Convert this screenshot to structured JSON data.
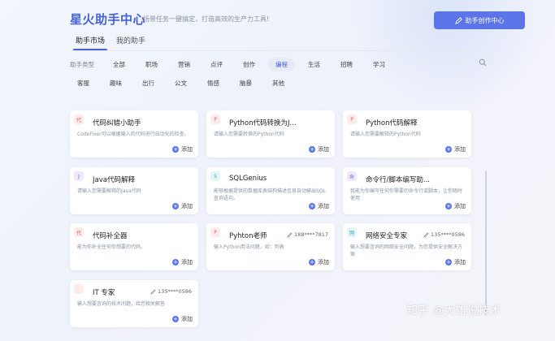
{
  "header": {
    "title": "星火助手中心",
    "slogan": "场景任务一键搞定，打造高效的生产力工具!",
    "create_button": "助手创作中心"
  },
  "tabs": [
    {
      "label": "助手市场",
      "active": true
    },
    {
      "label": "我的助手",
      "active": false
    }
  ],
  "filter": {
    "label": "助手类型",
    "row1": [
      "全部",
      "职场",
      "营销",
      "点评",
      "创作",
      "编程",
      "生活",
      "招聘",
      "学习"
    ],
    "row2": [
      "客服",
      "趣味",
      "出行",
      "公文",
      "情感",
      "脑暴",
      "其他"
    ],
    "active": "编程"
  },
  "add_label": "添加",
  "cards": [
    {
      "icon": "代",
      "icon_bg": "#fdecec",
      "icon_color": "#e05a5a",
      "title": "代码纠错小助手",
      "author": "",
      "desc": "CodeFixer可以根据输入的代码进行自动化的检查。"
    },
    {
      "icon": "P",
      "icon_bg": "#fdecec",
      "icon_color": "#e05a5a",
      "title": "Python代码转换为J...",
      "author": "",
      "desc": "请输入您需要转换的Python代码"
    },
    {
      "icon": "P",
      "icon_bg": "#fdecec",
      "icon_color": "#e05a5a",
      "title": "Python代码解释",
      "author": "",
      "desc": "请输入您需要解释的Python代码"
    },
    {
      "icon": "J",
      "icon_bg": "#efe9fb",
      "icon_color": "#7a5ad8",
      "title": "Java代码解释",
      "author": "",
      "desc": "请输入您需要解释的Java代码"
    },
    {
      "icon": "S",
      "icon_bg": "#e6f5f8",
      "icon_color": "#3aa3b8",
      "title": "SQLGenius",
      "author": "",
      "desc": "能够根据提供的数据库表结构描述信息自动输出SQL查询语句。"
    },
    {
      "icon": "命",
      "icon_bg": "#efe9fb",
      "icon_color": "#7a5ad8",
      "title": "命令行/脚本编写助...",
      "author": "",
      "desc": "我能为你编写任何你需要的命令行或脚本，让你随时使用"
    },
    {
      "icon": "代",
      "icon_bg": "#fdecec",
      "icon_color": "#e05a5a",
      "title": "代码补全器",
      "author": "",
      "desc": "能为你补全任何你想要的代码。"
    },
    {
      "icon": "P",
      "icon_bg": "#fdecec",
      "icon_color": "#e05a5a",
      "title": "Pyhton老师",
      "author": "188****7817",
      "desc": "输入Python用法问题，如：列表"
    },
    {
      "icon": "网",
      "icon_bg": "#e6f5f8",
      "icon_color": "#3aa3b8",
      "title": "网络安全专家",
      "author": "135****0586",
      "desc": "输入想要咨询的网络安全问题，为您提供安全解决方案"
    },
    {
      "icon": "",
      "icon_bg": "#fdecec",
      "icon_color": "#e05a5a",
      "title": "IT 专家",
      "author": "135****0586",
      "desc": "输入想要咨询的技术问题，给您相关解答"
    }
  ],
  "watermark": "知乎 @大雄说技术"
}
